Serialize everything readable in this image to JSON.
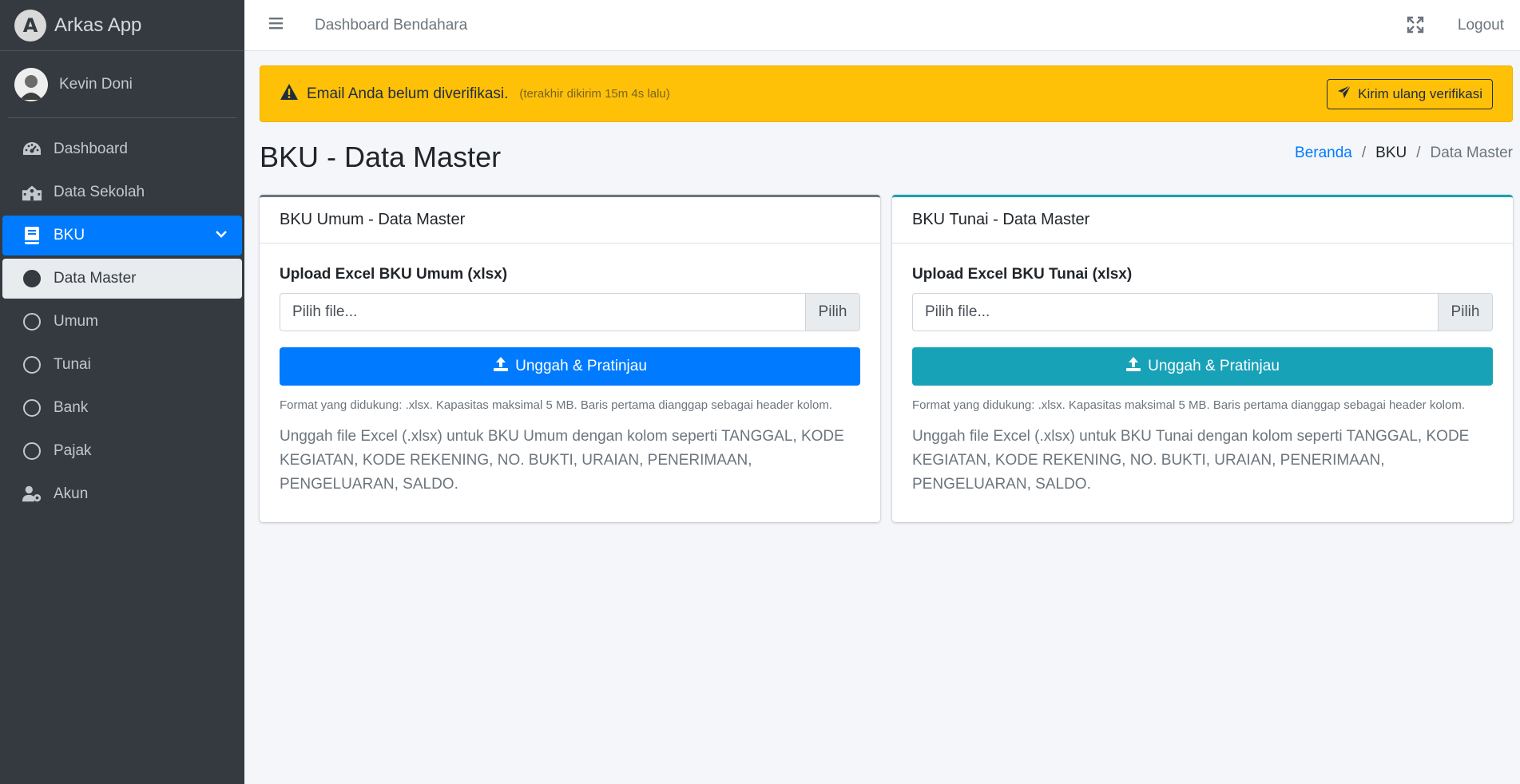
{
  "brand": {
    "logo_letter": "A",
    "name": "Arkas App"
  },
  "user": {
    "name": "Kevin Doni"
  },
  "sidebar": {
    "items": [
      {
        "label": "Dashboard",
        "icon": "tachometer-icon"
      },
      {
        "label": "Data Sekolah",
        "icon": "school-icon"
      },
      {
        "label": "BKU",
        "icon": "book-icon"
      },
      {
        "label": "Data Master",
        "icon": "circle-filled-icon"
      },
      {
        "label": "Umum",
        "icon": "circle-outline-icon"
      },
      {
        "label": "Tunai",
        "icon": "circle-outline-icon"
      },
      {
        "label": "Bank",
        "icon": "circle-outline-icon"
      },
      {
        "label": "Pajak",
        "icon": "circle-outline-icon"
      },
      {
        "label": "Akun",
        "icon": "user-cog-icon"
      }
    ],
    "active_color": "#007bff",
    "bg_color": "#343a40"
  },
  "topbar": {
    "title": "Dashboard Bendahara",
    "logout_label": "Logout"
  },
  "alert": {
    "message": "Email Anda belum diverifikasi.",
    "sub": "(terakhir dikirim 15m 4s lalu)",
    "button_label": "Kirim ulang verifikasi",
    "color": "#ffc107"
  },
  "page": {
    "title": "BKU - Data Master",
    "breadcrumb": [
      "Beranda",
      "BKU",
      "Data Master"
    ]
  },
  "cards": [
    {
      "header": "BKU Umum - Data Master",
      "label": "Upload Excel BKU Umum (xlsx)",
      "placeholder": "Pilih file...",
      "browse": "Pilih",
      "button": "Unggah & Pratinjau",
      "hint": "Format yang didukung: .xlsx. Kapasitas maksimal 5 MB. Baris pertama dianggap sebagai header kolom.",
      "desc": "Unggah file Excel (.xlsx) untuk BKU Umum dengan kolom seperti TANGGAL, KODE KEGIATAN, KODE REKENING, NO. BUKTI, URAIAN, PENERIMAAN, PENGELUARAN, SALDO.",
      "accent": "#007bff"
    },
    {
      "header": "BKU Tunai - Data Master",
      "label": "Upload Excel BKU Tunai (xlsx)",
      "placeholder": "Pilih file...",
      "browse": "Pilih",
      "button": "Unggah & Pratinjau",
      "hint": "Format yang didukung: .xlsx. Kapasitas maksimal 5 MB. Baris pertama dianggap sebagai header kolom.",
      "desc": "Unggah file Excel (.xlsx) untuk BKU Tunai dengan kolom seperti TANGGAL, KODE KEGIATAN, KODE REKENING, NO. BUKTI, URAIAN, PENERIMAAN, PENGELUARAN, SALDO.",
      "accent": "#17a2b8"
    }
  ]
}
